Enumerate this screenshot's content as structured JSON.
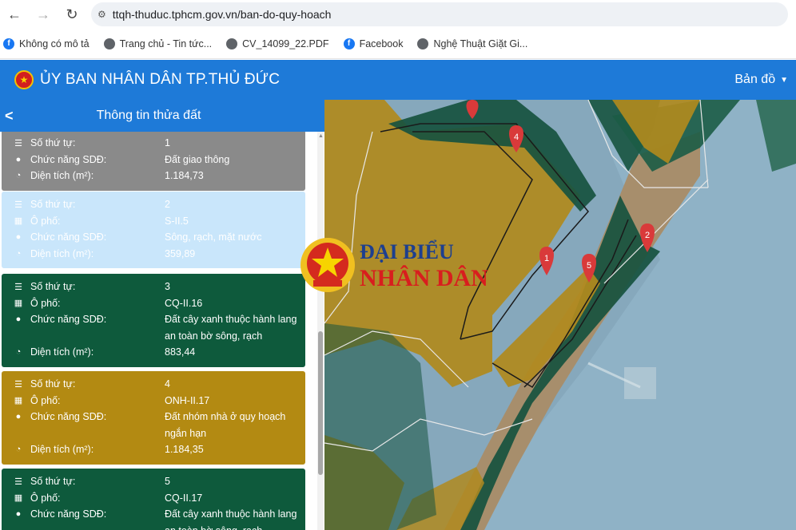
{
  "browser": {
    "url": "ttqh-thuduc.tphcm.gov.vn/ban-do-quy-hoach",
    "bookmarks": [
      {
        "label": "Không có mô tả",
        "icon": "facebook-icon"
      },
      {
        "label": "Trang chủ - Tin tức...",
        "icon": "globe-icon"
      },
      {
        "label": "CV_14099_22.PDF",
        "icon": "globe-icon"
      },
      {
        "label": "Facebook",
        "icon": "facebook-icon"
      },
      {
        "label": "Nghệ Thuật Giặt Gi...",
        "icon": "globe-icon"
      }
    ]
  },
  "app": {
    "title": "ỦY BAN NHÂN DÂN TP.THỦ ĐỨC",
    "map_menu": "Bản đồ",
    "brand_color": "#1e7ad8"
  },
  "panel": {
    "title": "Thông tin thửa đất",
    "cards": [
      {
        "color": "#8a8a8a",
        "rows": [
          {
            "icon": "list-icon",
            "label": "Số thứ tự:",
            "value": "1"
          },
          {
            "icon": "globe-icon",
            "label": "Chức năng SDĐ:",
            "value": "Đất giao thông"
          },
          {
            "icon": "pie-icon",
            "label": "Diện tích (m²):",
            "value": "1.184,73"
          }
        ]
      },
      {
        "color": "#c9e6fb",
        "rows": [
          {
            "icon": "list-icon",
            "label": "Số thứ tự:",
            "value": "2"
          },
          {
            "icon": "grid-icon",
            "label": "Ô phố:",
            "value": "S-II.5"
          },
          {
            "icon": "globe-icon",
            "label": "Chức năng SDĐ:",
            "value": "Sông, rạch, mặt nước"
          },
          {
            "icon": "pie-icon",
            "label": "Diện tích (m²):",
            "value": "359,89"
          }
        ]
      },
      {
        "color": "#0e5a3c",
        "rows": [
          {
            "icon": "list-icon",
            "label": "Số thứ tự:",
            "value": "3"
          },
          {
            "icon": "grid-icon",
            "label": "Ô phố:",
            "value": "CQ-II.16"
          },
          {
            "icon": "globe-icon",
            "label": "Chức năng SDĐ:",
            "value": "Đất cây xanh thuộc hành lang an toàn bờ sông, rạch"
          },
          {
            "icon": "pie-icon",
            "label": "Diện tích (m²):",
            "value": "883,44"
          }
        ]
      },
      {
        "color": "#b38a12",
        "rows": [
          {
            "icon": "list-icon",
            "label": "Số thứ tự:",
            "value": "4"
          },
          {
            "icon": "grid-icon",
            "label": "Ô phố:",
            "value": "ONH-II.17"
          },
          {
            "icon": "globe-icon",
            "label": "Chức năng SDĐ:",
            "value": "Đất nhóm nhà ở quy hoạch ngắn hạn"
          },
          {
            "icon": "pie-icon",
            "label": "Diện tích (m²):",
            "value": "1.184,35"
          }
        ]
      },
      {
        "color": "#0e5a3c",
        "rows": [
          {
            "icon": "list-icon",
            "label": "Số thứ tự:",
            "value": "5"
          },
          {
            "icon": "grid-icon",
            "label": "Ô phố:",
            "value": "CQ-II.17"
          },
          {
            "icon": "globe-icon",
            "label": "Chức năng SDĐ:",
            "value": "Đất cây xanh thuộc hành lang an toàn bờ sông, rạch"
          }
        ]
      }
    ]
  },
  "map": {
    "markers": [
      "1",
      "2",
      "4",
      "5"
    ]
  },
  "watermark": {
    "line1": "ĐẠI BIỂU",
    "line2": "NHÂN DÂN"
  }
}
